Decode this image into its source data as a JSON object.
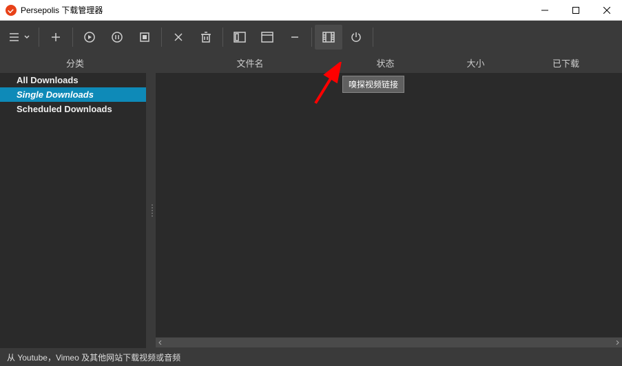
{
  "window": {
    "title": "Persepolis 下载管理器"
  },
  "toolbar": {
    "tooltip": "嗅探视频链接"
  },
  "sidebar": {
    "header": "分类",
    "items": [
      {
        "label": "All Downloads",
        "selected": false
      },
      {
        "label": "Single Downloads",
        "selected": true
      },
      {
        "label": "Scheduled Downloads",
        "selected": false
      }
    ]
  },
  "columns": {
    "file": "文件名",
    "status": "状态",
    "size": "大小",
    "downloaded": "已下载"
  },
  "statusbar": {
    "text": "从 Youtube，Vimeo 及其他网站下载视频或音频"
  }
}
